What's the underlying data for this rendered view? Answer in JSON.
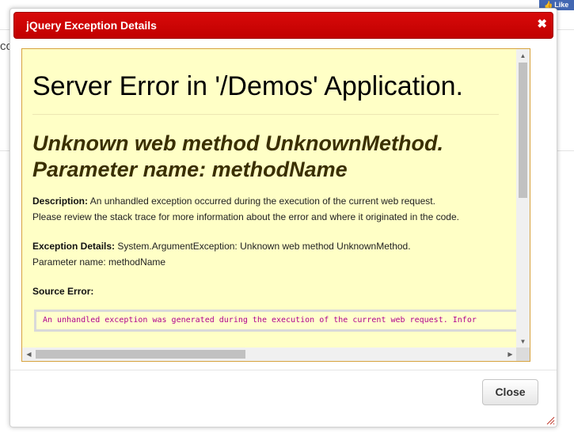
{
  "background": {
    "fragment_text": "co",
    "like_label": "Like"
  },
  "dialog": {
    "title": "jQuery Exception Details",
    "close_glyph": "✖",
    "content": {
      "heading": "Server Error in '/Demos' Application.",
      "subheading_line1": "Unknown web method UnknownMethod.",
      "subheading_line2": "Parameter name: methodName",
      "description_label": "Description:",
      "description_text1": " An unhandled exception occurred during the execution of the current web request.",
      "description_text2": "Please review the stack trace for more information about the error and where it originated in the code.",
      "exception_label": "Exception Details:",
      "exception_text1": " System.ArgumentException: Unknown web method UnknownMethod.",
      "exception_text2": "Parameter name: methodName",
      "source_error_label": "Source Error:",
      "source_code_text": "An unhandled exception was generated during the execution of the current web request. Infor"
    },
    "close_button_label": "Close"
  },
  "colors": {
    "titlebar": "#c80000",
    "content_background": "#ffffc6",
    "code_text": "#b0008e"
  },
  "icons": {
    "titlebar_close": "close-icon",
    "scroll_up": "triangle-up-icon",
    "scroll_down": "triangle-down-icon",
    "scroll_left": "triangle-left-icon",
    "scroll_right": "triangle-right-icon",
    "resize": "resize-grip-icon"
  }
}
